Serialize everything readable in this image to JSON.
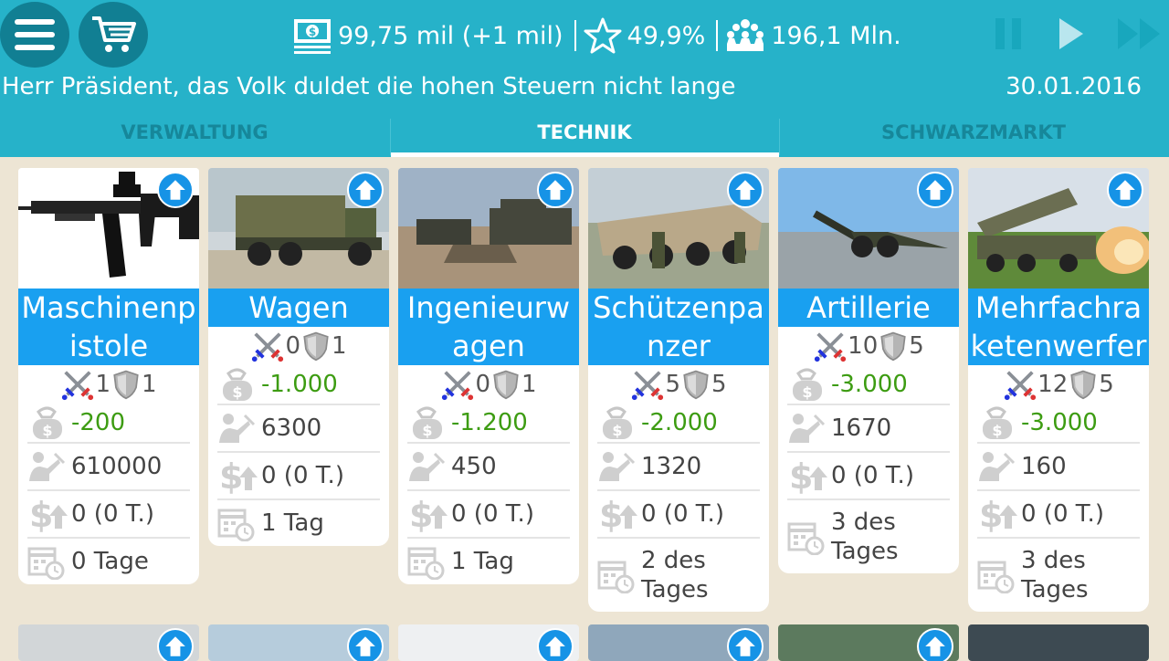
{
  "stats": {
    "money": "99,75 mil (+1 mil)",
    "rating": "49,9%",
    "population": "196,1 Mln."
  },
  "message": "Herr Präsident, das Volk duldet die hohen Steuern nicht lange",
  "date": "30.01.2016",
  "tabs": [
    "VERWALTUNG",
    "TECHNIK",
    "SCHWARZMARKT"
  ],
  "icons": {
    "menu": "menu-icon",
    "cart": "cart-icon",
    "money": "money-icon",
    "star": "star-icon",
    "people": "people-icon",
    "pause": "pause-icon",
    "play": "play-icon",
    "fast_forward": "fast-forward-icon",
    "upgrade": "arrow-up-icon",
    "sword": "crossed-swords-icon",
    "shield": "shield-icon",
    "cost": "money-bag-icon",
    "soldiers": "soldier-icon",
    "income": "dollar-up-icon",
    "time": "calendar-clock-icon"
  },
  "colors": {
    "header": "#26b2c9",
    "accent": "#19a0f0",
    "positive": "#3d9c12",
    "background": "#ede5d4"
  },
  "cards": [
    {
      "name": "Maschinenpistole",
      "attack": "1",
      "defense": "1",
      "cost": "-200",
      "count": "610000",
      "income": "0 (0 T.)",
      "time": "0 Tage"
    },
    {
      "name": "Wagen",
      "attack": "0",
      "defense": "1",
      "cost": "-1.000",
      "count": "6300",
      "income": "0 (0 T.)",
      "time": "1 Tag"
    },
    {
      "name": "Ingenieurwagen",
      "attack": "0",
      "defense": "1",
      "cost": "-1.200",
      "count": "450",
      "income": "0 (0 T.)",
      "time": "1 Tag"
    },
    {
      "name": "Schützenpanzer",
      "attack": "5",
      "defense": "5",
      "cost": "-2.000",
      "count": "1320",
      "income": "0 (0 T.)",
      "time": "2 des Tages"
    },
    {
      "name": "Artillerie",
      "attack": "10",
      "defense": "5",
      "cost": "-3.000",
      "count": "1670",
      "income": "0 (0 T.)",
      "time": "3 des Tages"
    },
    {
      "name": "Mehrfachraketenwerfer",
      "attack": "12",
      "defense": "5",
      "cost": "-3.000",
      "count": "160",
      "income": "0 (0 T.)",
      "time": "3 des Tages"
    }
  ]
}
